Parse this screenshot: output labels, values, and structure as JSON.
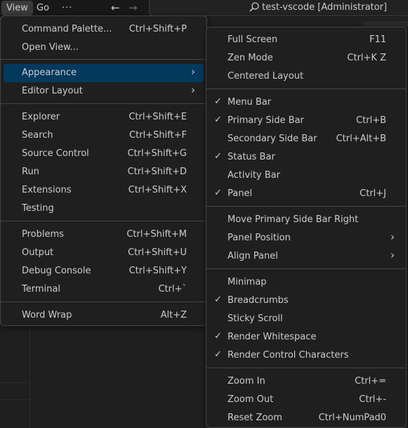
{
  "titlebar": {
    "menus": [
      "View",
      "Go"
    ],
    "more": "···",
    "back": "←",
    "forward": "→",
    "search_text": "test-vscode [Administrator]"
  },
  "view_menu": {
    "items": [
      {
        "label": "Command Palette...",
        "key": "Ctrl+Shift+P"
      },
      {
        "label": "Open View...",
        "key": ""
      },
      {
        "label": "Appearance",
        "key": "",
        "submenu": true,
        "highlighted": true
      },
      {
        "label": "Editor Layout",
        "key": "",
        "submenu": true
      },
      {
        "label": "Explorer",
        "key": "Ctrl+Shift+E"
      },
      {
        "label": "Search",
        "key": "Ctrl+Shift+F"
      },
      {
        "label": "Source Control",
        "key": "Ctrl+Shift+G"
      },
      {
        "label": "Run",
        "key": "Ctrl+Shift+D"
      },
      {
        "label": "Extensions",
        "key": "Ctrl+Shift+X"
      },
      {
        "label": "Testing",
        "key": ""
      },
      {
        "label": "Problems",
        "key": "Ctrl+Shift+M"
      },
      {
        "label": "Output",
        "key": "Ctrl+Shift+U"
      },
      {
        "label": "Debug Console",
        "key": "Ctrl+Shift+Y"
      },
      {
        "label": "Terminal",
        "key": "Ctrl+`"
      },
      {
        "label": "Word Wrap",
        "key": "Alt+Z"
      }
    ]
  },
  "appearance_menu": {
    "items": [
      {
        "label": "Full Screen",
        "key": "F11",
        "checked": false
      },
      {
        "label": "Zen Mode",
        "key": "Ctrl+K Z",
        "checked": false
      },
      {
        "label": "Centered Layout",
        "key": "",
        "checked": false
      },
      {
        "label": "Menu Bar",
        "key": "",
        "checked": true
      },
      {
        "label": "Primary Side Bar",
        "key": "Ctrl+B",
        "checked": true
      },
      {
        "label": "Secondary Side Bar",
        "key": "Ctrl+Alt+B",
        "checked": false
      },
      {
        "label": "Status Bar",
        "key": "",
        "checked": true
      },
      {
        "label": "Activity Bar",
        "key": "",
        "checked": false
      },
      {
        "label": "Panel",
        "key": "Ctrl+J",
        "checked": true
      },
      {
        "label": "Move Primary Side Bar Right",
        "key": "",
        "checked": false
      },
      {
        "label": "Panel Position",
        "key": "",
        "submenu": true
      },
      {
        "label": "Align Panel",
        "key": "",
        "submenu": true
      },
      {
        "label": "Minimap",
        "key": "",
        "checked": false
      },
      {
        "label": "Breadcrumbs",
        "key": "",
        "checked": true
      },
      {
        "label": "Sticky Scroll",
        "key": "",
        "checked": false
      },
      {
        "label": "Render Whitespace",
        "key": "",
        "checked": true
      },
      {
        "label": "Render Control Characters",
        "key": "",
        "checked": true
      },
      {
        "label": "Zoom In",
        "key": "Ctrl+=",
        "checked": false
      },
      {
        "label": "Zoom Out",
        "key": "Ctrl+-",
        "checked": false
      },
      {
        "label": "Reset Zoom",
        "key": "Ctrl+NumPad0",
        "checked": false
      }
    ]
  },
  "glyphs": {
    "check": "✓",
    "submenu_arrow": "›"
  },
  "colors": {
    "highlight": "#04395e",
    "menu_bg": "#1f1f1f",
    "border": "#454545"
  }
}
